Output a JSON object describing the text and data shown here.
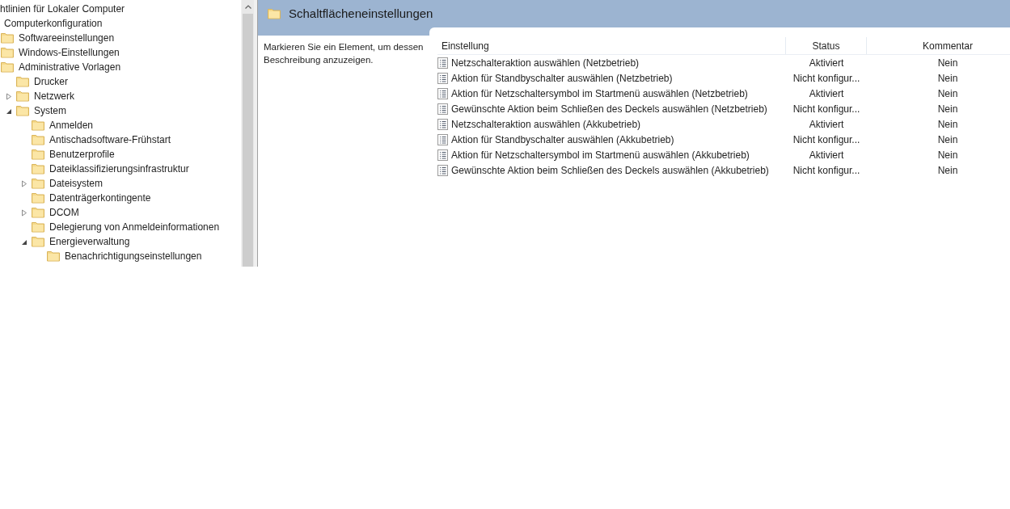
{
  "tree": [
    {
      "label": "htlinien für Lokaler Computer",
      "children": [
        {
          "label": "Computerkonfiguration",
          "children": [
            {
              "label": "Softwareeinstellungen"
            },
            {
              "label": "Windows-Einstellungen"
            },
            {
              "label": "Administrative Vorlagen",
              "children": [
                {
                  "label": "Drucker",
                  "has_children": false
                },
                {
                  "label": "Netzwerk",
                  "has_children": true,
                  "expanded": false
                },
                {
                  "label": "System",
                  "has_children": true,
                  "expanded": true,
                  "children": [
                    {
                      "label": "Anmelden",
                      "has_children": false
                    },
                    {
                      "label": "Antischadsoftware-Frühstart",
                      "has_children": false
                    },
                    {
                      "label": "Benutzerprofile",
                      "has_children": false
                    },
                    {
                      "label": "Dateiklassifizierungsinfrastruktur",
                      "has_children": false
                    },
                    {
                      "label": "Dateisystem",
                      "has_children": true,
                      "expanded": false
                    },
                    {
                      "label": "Datenträgerkontingente",
                      "has_children": false
                    },
                    {
                      "label": "DCOM",
                      "has_children": true,
                      "expanded": false
                    },
                    {
                      "label": "Delegierung von Anmeldeinformationen",
                      "has_children": false
                    },
                    {
                      "label": "Energieverwaltung",
                      "has_children": true,
                      "expanded": true,
                      "children": [
                        {
                          "label": "Benachrichtigungseinstellungen",
                          "has_children": false
                        }
                      ]
                    }
                  ]
                }
              ]
            }
          ]
        }
      ]
    }
  ],
  "header": {
    "title": "Schaltflächeneinstellungen"
  },
  "description": "Markieren Sie ein Element, um dessen Beschreibung anzuzeigen.",
  "table": {
    "columns": [
      "Einstellung",
      "Status",
      "Kommentar"
    ],
    "rows": [
      {
        "setting": "Netzschalteraktion auswählen (Netzbetrieb)",
        "status": "Aktiviert",
        "comment": "Nein"
      },
      {
        "setting": "Aktion für Standbyschalter auswählen (Netzbetrieb)",
        "status": "Nicht konfigur...",
        "comment": "Nein"
      },
      {
        "setting": "Aktion für Netzschaltersymbol im Startmenü auswählen (Netzbetrieb)",
        "status": "Aktiviert",
        "comment": "Nein"
      },
      {
        "setting": "Gewünschte Aktion beim Schließen des Deckels auswählen (Netzbetrieb)",
        "status": "Nicht konfigur...",
        "comment": "Nein"
      },
      {
        "setting": "Netzschalteraktion auswählen (Akkubetrieb)",
        "status": "Aktiviert",
        "comment": "Nein"
      },
      {
        "setting": "Aktion für Standbyschalter auswählen (Akkubetrieb)",
        "status": "Nicht konfigur...",
        "comment": "Nein"
      },
      {
        "setting": "Aktion für Netzschaltersymbol im Startmenü auswählen (Akkubetrieb)",
        "status": "Aktiviert",
        "comment": "Nein"
      },
      {
        "setting": "Gewünschte Aktion beim Schließen des Deckels auswählen (Akkubetrieb)",
        "status": "Nicht konfigur...",
        "comment": "Nein"
      }
    ]
  }
}
